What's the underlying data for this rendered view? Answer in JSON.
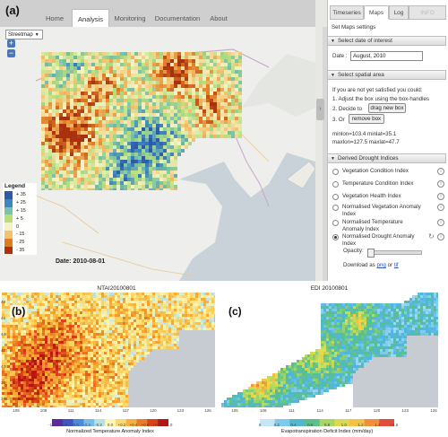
{
  "panel_a": {
    "label": "(a)",
    "nav": {
      "tabs": [
        "Home",
        "Analysis",
        "Monitoring",
        "Documentation",
        "About"
      ],
      "active": "Analysis"
    },
    "basemap_select": "Streetmap",
    "zoom_in": "+",
    "zoom_out": "−",
    "date_overlay": "Date: 2010-08-01",
    "legend": {
      "title": "Legend",
      "items": [
        {
          "label": "+ 35",
          "color": "#2c5aa8"
        },
        {
          "label": "+ 25",
          "color": "#3f86c0"
        },
        {
          "label": "+ 15",
          "color": "#7cc3a6"
        },
        {
          "label": "+ 5",
          "color": "#b8de7a"
        },
        {
          "label": "0",
          "color": "#f5f3c6"
        },
        {
          "label": "- 15",
          "color": "#f2c36c"
        },
        {
          "label": "- 25",
          "color": "#e07b24"
        },
        {
          "label": "- 35",
          "color": "#a8320f"
        }
      ]
    },
    "side": {
      "tabs": [
        "Timeseries",
        "Maps",
        "Log",
        "INFO"
      ],
      "active_tab": "Maps",
      "title": "Set Maps settings",
      "sec_date": "Select date of interest",
      "date_label": "Date :",
      "date_value": "August, 2010",
      "sec_area": "Select spatial area",
      "area_line1": "If you are not yet satisfied you could:",
      "area_line2": "1. Adjust the box using the box-handles",
      "area_line3": "2. Decide to",
      "drag_button": "drag new box",
      "area_line4": "3. Or",
      "remove_button": "remove box",
      "coords1": "minlon=103.4 minlat=35.1",
      "coords2": "maxlon=127.5 maxlat=47.7",
      "sec_indices": "Derived Drought Indices",
      "indices": [
        "Vegetation Condition Index",
        "Temperature Condition Index",
        "Vegetation Health Index",
        "Normalised Vegetation Anomaly Index",
        "Normalised Temperature Anomaly Index",
        "Normalised Drought Anomaly Index"
      ],
      "selected_index": "Normalised Drought Anomaly Index",
      "opacity_label": "Opacity:",
      "download_prefix": "Download as",
      "download_png": "png",
      "download_or": "or",
      "download_tif": "tif"
    }
  },
  "panel_b": {
    "label": "(b)",
    "title": "NTAI20100801",
    "y_ticks": [
      "48",
      "46",
      "44",
      "42",
      "40",
      "38",
      "36"
    ],
    "x_ticks": [
      "105",
      "108",
      "111",
      "114",
      "117",
      "120",
      "123",
      "126"
    ],
    "colorbar": {
      "ticks": [
        "-1.0",
        "-0.8",
        "-0.6",
        "-0.4",
        "-0.2",
        "0.0",
        "+0.2",
        "+0.4",
        "+0.6",
        "+0.8",
        "+1.0"
      ],
      "label": "Normalized Temperature Anomaly Index"
    }
  },
  "panel_c": {
    "label": "(c)",
    "title": "EDI 20100801",
    "x_ticks": [
      "105",
      "108",
      "111",
      "114",
      "117",
      "120",
      "123",
      "126"
    ],
    "colorbar": {
      "ticks": [
        "0",
        "0.2",
        "0.4",
        "0.6",
        "0.8",
        "1.0",
        "1.2",
        "1.4",
        "+1.6"
      ],
      "label": "Evapotranspiration Deficit Index (mm/day)"
    }
  },
  "colors": {
    "nav_bg": "#cfcfcf",
    "map_bg": "#eeeeec",
    "sea": "#c5cdd3",
    "zoom_btn": "#4a78b7"
  }
}
